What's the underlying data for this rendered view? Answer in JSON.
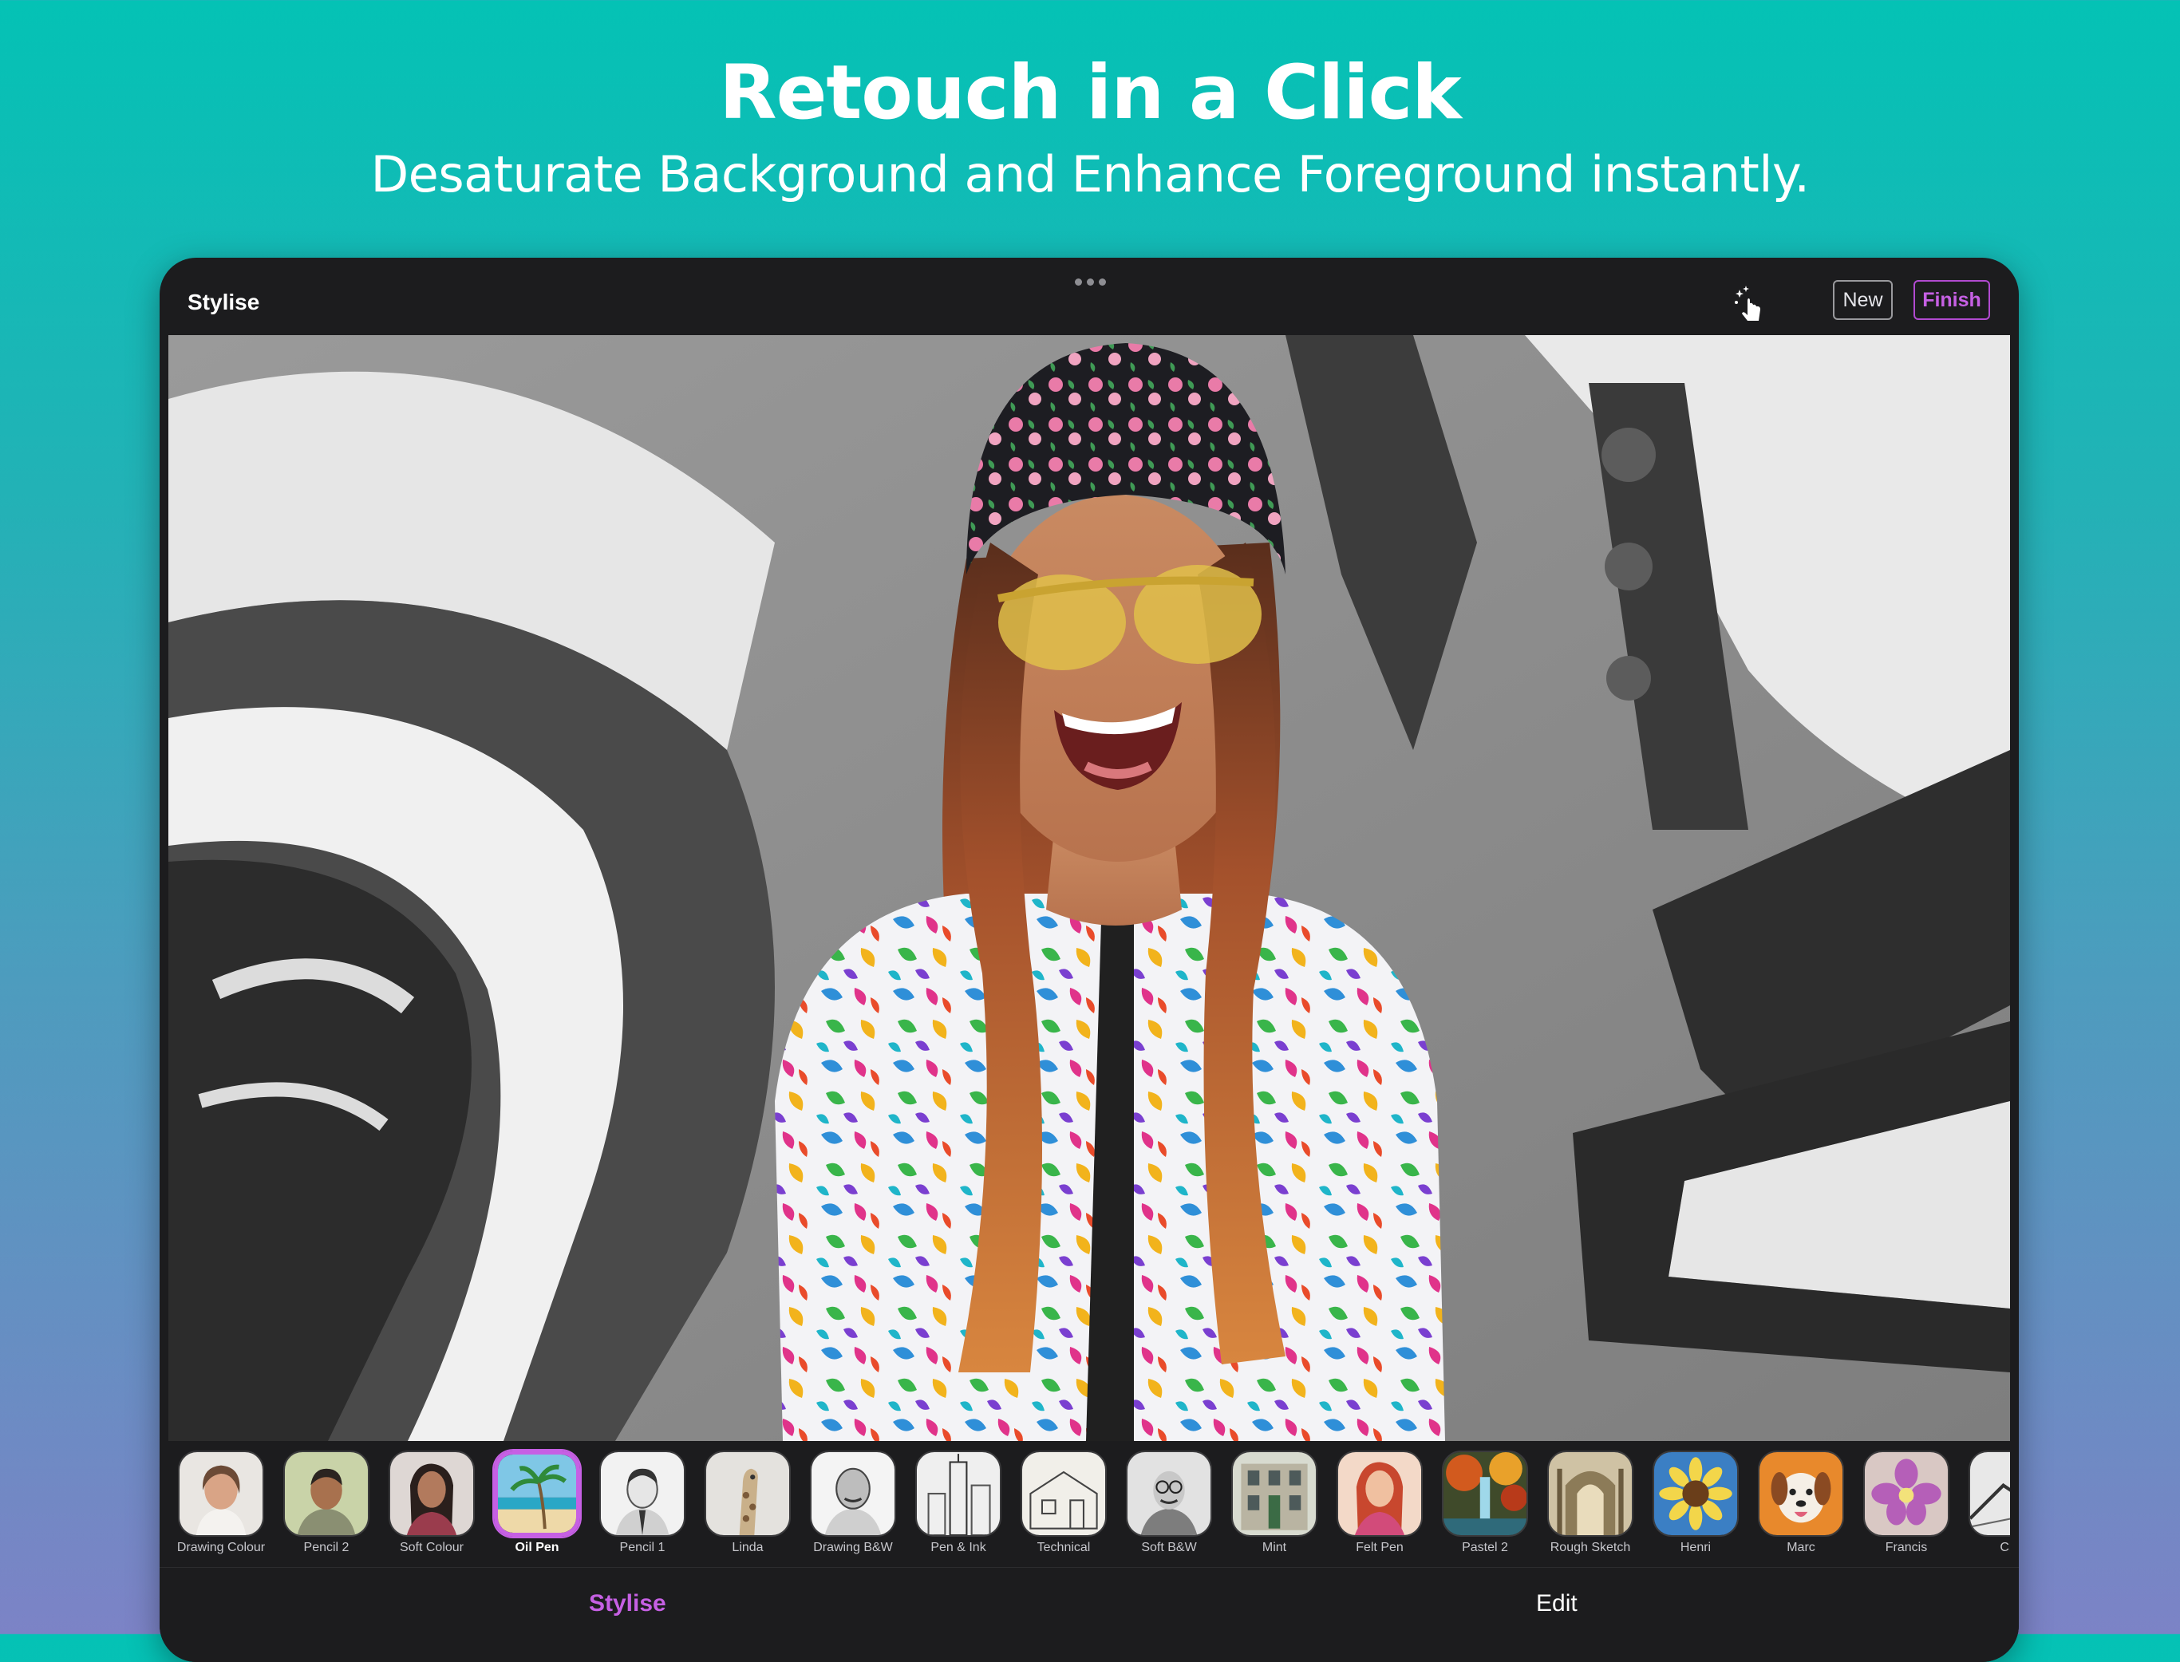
{
  "marketing": {
    "headline": "Retouch in a Click",
    "subheadline": "Desaturate Background and Enhance Foreground instantly."
  },
  "toolbar": {
    "title": "Stylise",
    "new_label": "New",
    "finish_label": "Finish",
    "gesture_icon": "magic-tap-icon"
  },
  "filters": [
    {
      "label": "Drawing Colour",
      "thumb": "portrait-smiling-woman",
      "selected": false
    },
    {
      "label": "Pencil 2",
      "thumb": "portrait-man",
      "selected": false
    },
    {
      "label": "Soft Colour",
      "thumb": "portrait-woman",
      "selected": false
    },
    {
      "label": "Oil Pen",
      "thumb": "beach-palm",
      "selected": true
    },
    {
      "label": "Pencil 1",
      "thumb": "portrait-man-bw",
      "selected": false
    },
    {
      "label": "Linda",
      "thumb": "giraffe",
      "selected": false
    },
    {
      "label": "Drawing B&W",
      "thumb": "portrait-man-bald",
      "selected": false
    },
    {
      "label": "Pen & Ink",
      "thumb": "city-sketch",
      "selected": false
    },
    {
      "label": "Technical",
      "thumb": "house-sketch",
      "selected": false
    },
    {
      "label": "Soft B&W",
      "thumb": "portrait-man-glasses",
      "selected": false
    },
    {
      "label": "Mint",
      "thumb": "building-facade",
      "selected": false
    },
    {
      "label": "Felt Pen",
      "thumb": "portrait-redhead",
      "selected": false
    },
    {
      "label": "Pastel 2",
      "thumb": "autumn-waterfall",
      "selected": false
    },
    {
      "label": "Rough Sketch",
      "thumb": "church-interior",
      "selected": false
    },
    {
      "label": "Henri",
      "thumb": "sunflower",
      "selected": false
    },
    {
      "label": "Marc",
      "thumb": "dog",
      "selected": false
    },
    {
      "label": "Francis",
      "thumb": "orchid",
      "selected": false
    },
    {
      "label": "Cha",
      "thumb": "partial-sketch",
      "selected": false
    }
  ],
  "tabs": {
    "stylise": "Stylise",
    "edit": "Edit"
  },
  "colors": {
    "accent": "#c660e4",
    "background_top": "#04c2b5",
    "background_bottom": "#7c83c6",
    "device": "#1c1c1e"
  }
}
